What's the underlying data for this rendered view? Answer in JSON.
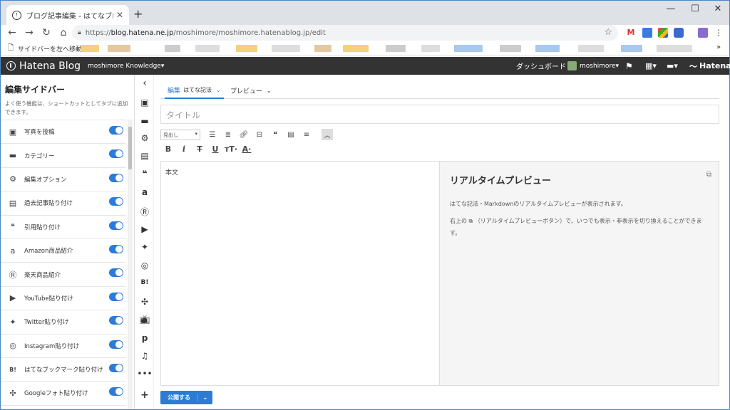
{
  "browser": {
    "tab_title": "ブログ記事編集 - はてなブログ",
    "url_host": "blog.hatena.ne.jp",
    "url_path": "/moshimore/moshimore.hatenablog.jp/edit",
    "url_scheme": "https://",
    "bookmark_first": "サイドバーを左へ移動"
  },
  "header": {
    "logo": "Hatena Blog",
    "blog_name": "moshimore Knowledge",
    "dashboard": "ダッシュボード",
    "user": "moshimore",
    "brand": "Hatena"
  },
  "sidebar": {
    "title": "編集サイドバー",
    "description": "よく使う機能は、ショートカットとしてタブに追加できます。",
    "items": [
      {
        "label": "写真を投稿",
        "icon": "photo-icon"
      },
      {
        "label": "カテゴリー",
        "icon": "folder-icon"
      },
      {
        "label": "編集オプション",
        "icon": "gear-icon"
      },
      {
        "label": "過去記事貼り付け",
        "icon": "document-icon"
      },
      {
        "label": "引用貼り付け",
        "icon": "quote-icon"
      },
      {
        "label": "Amazon商品紹介",
        "icon": "amazon-icon"
      },
      {
        "label": "楽天商品紹介",
        "icon": "rakuten-icon"
      },
      {
        "label": "YouTube貼り付け",
        "icon": "youtube-icon"
      },
      {
        "label": "Twitter貼り付け",
        "icon": "twitter-icon"
      },
      {
        "label": "Instagram貼り付け",
        "icon": "instagram-icon"
      },
      {
        "label": "はてなブックマーク貼り付け",
        "icon": "hatena-bookmark-icon"
      },
      {
        "label": "Googleフォト貼り付け",
        "icon": "google-photos-icon"
      }
    ]
  },
  "editor": {
    "tab_edit": "編集",
    "tab_edit_mode": "はてな記法",
    "tab_preview": "プレビュー",
    "title_placeholder": "タイトル",
    "heading_select": "見出し",
    "body_placeholder": "本文",
    "publish": "公開する"
  },
  "preview": {
    "title": "リアルタイムプレビュー",
    "line1": "はてな記法・Markdownのリアルタイムプレビューが表示されます。",
    "line2_pre": "右上の",
    "line2_post": "（リアルタイムプレビューボタン）で、いつでも表示・非表示を切り換えることができます。"
  },
  "colors": {
    "accent": "#2d7bd4",
    "header_bg": "#333333"
  }
}
